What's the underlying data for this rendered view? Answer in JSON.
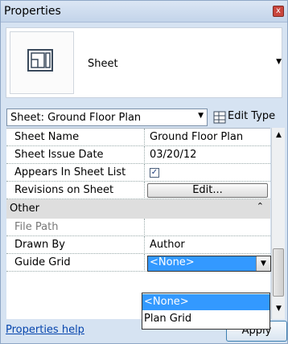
{
  "window": {
    "title": "Properties",
    "close_glyph": "x"
  },
  "type_selector": {
    "name": "Sheet",
    "icon": "sheet-icon"
  },
  "instance_filter": {
    "value": "Sheet: Ground Floor Plan",
    "edit_type_label": "Edit Type"
  },
  "properties": [
    {
      "name": "Sheet Name",
      "value": "Ground Floor Plan"
    },
    {
      "name": "Sheet Issue Date",
      "value": "03/20/12"
    },
    {
      "name": "Appears In Sheet List",
      "checked": true
    },
    {
      "name": "Revisions on Sheet",
      "button_label": "Edit..."
    }
  ],
  "category_other": {
    "label": "Other"
  },
  "other_properties": [
    {
      "name": "File Path",
      "value": ""
    },
    {
      "name": "Drawn By",
      "value": "Author"
    },
    {
      "name": "Guide Grid",
      "value": "<None>"
    }
  ],
  "guide_grid_dropdown": {
    "options": [
      "<None>",
      "Plan Grid"
    ],
    "highlighted": "<None>"
  },
  "footer": {
    "help_link": "Properties help",
    "apply_label": "Apply"
  }
}
